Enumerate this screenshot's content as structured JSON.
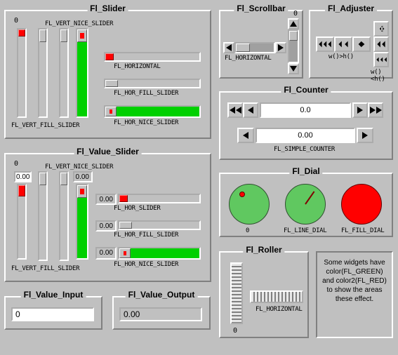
{
  "slider_panel": {
    "title": "Fl_Slider",
    "top_left": "0",
    "vnice_label": "FL_VERT_NICE_SLIDER",
    "vfill_label": "FL_VERT_FILL_SLIDER",
    "h_label": "FL_HORIZONTAL",
    "hfill_label": "FL_HOR_FILL_SLIDER",
    "hnice_label": "FL_HOR_NICE_SLIDER"
  },
  "value_slider_panel": {
    "title": "Fl_Value_Slider",
    "top_left": "0",
    "v_nice_val": "0.00",
    "v_fill_val": "0.00",
    "h_val": "0.00",
    "h_fill_val": "0.00",
    "h_nice_val": "0.00",
    "vnice_label": "FL_VERT_NICE_SLIDER",
    "vfill_label": "FL_VERT_FILL_SLIDER",
    "hslider_label": "FL_HOR_SLIDER",
    "hfill_label": "FL_HOR_FILL_SLIDER",
    "hnice_label": "FL_HOR_NICE_SLIDER"
  },
  "value_input": {
    "title": "Fl_Value_Input",
    "value": "0"
  },
  "value_output": {
    "title": "Fl_Value_Output",
    "value": "0.00"
  },
  "scrollbar": {
    "title": "Fl_Scrollbar",
    "top_right": "0",
    "h_label": "FL_HORIZONTAL"
  },
  "adjuster": {
    "title": "Fl_Adjuster",
    "w_gt_h": "w()>h()",
    "w_lt_h": "w()<h()"
  },
  "counter": {
    "title": "Fl_Counter",
    "value1": "0.0",
    "value2": "0.00",
    "simple_label": "FL_SIMPLE_COUNTER"
  },
  "dial": {
    "title": "Fl_Dial",
    "label0": "0",
    "line_label": "FL_LINE_DIAL",
    "fill_label": "FL_FILL_DIAL"
  },
  "roller": {
    "title": "Fl_Roller",
    "zero": "0",
    "h_label": "FL_HORIZONTAL"
  },
  "info": "Some widgets have color(FL_GREEN) and color2(FL_RED) to show the areas these effect."
}
